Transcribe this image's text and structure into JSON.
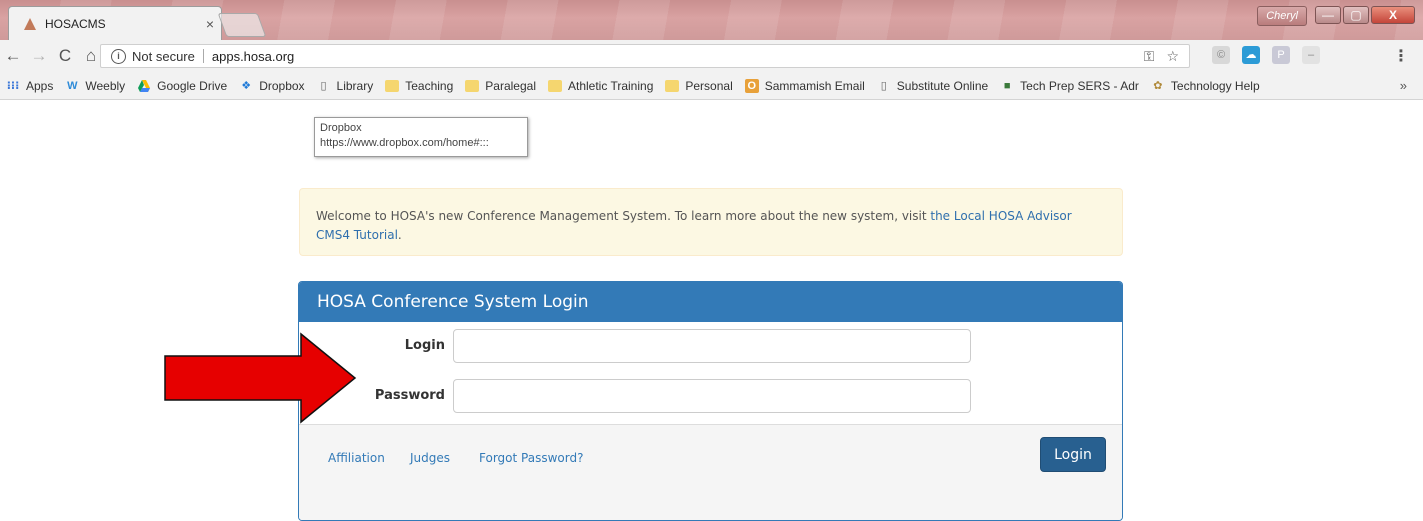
{
  "browser": {
    "tab_title": "HOSACMS",
    "tab_close": "×",
    "window_user": "Cheryl",
    "window_buttons": {
      "minimize": "—",
      "maximize": "▢",
      "close": "X"
    },
    "nav": {
      "back": "←",
      "forward": "→",
      "reload": "C",
      "home": "⌂"
    },
    "security_label": "Not secure",
    "url": "apps.hosa.org",
    "omnibox_icons": [
      "key-icon",
      "star-icon"
    ],
    "menu": "⋮"
  },
  "bookmarks": {
    "items": [
      {
        "label": "Apps",
        "icon": "apps-grid-icon"
      },
      {
        "label": "Weebly",
        "icon": "weebly-icon"
      },
      {
        "label": "Google Drive",
        "icon": "google-drive-icon"
      },
      {
        "label": "Dropbox",
        "icon": "dropbox-icon"
      },
      {
        "label": "Library",
        "icon": "page-icon"
      },
      {
        "label": "Teaching",
        "icon": "folder-icon"
      },
      {
        "label": "Paralegal",
        "icon": "folder-icon"
      },
      {
        "label": "Athletic Training",
        "icon": "folder-icon"
      },
      {
        "label": "Personal",
        "icon": "folder-icon"
      },
      {
        "label": "Sammamish Email",
        "icon": "outlook-icon"
      },
      {
        "label": "Substitute Online",
        "icon": "page-icon"
      },
      {
        "label": "Tech Prep SERS - Adr",
        "icon": "tech-prep-icon"
      },
      {
        "label": "Technology Help",
        "icon": "technology-help-icon"
      }
    ],
    "more": "»"
  },
  "tooltip": {
    "title": "Dropbox",
    "url": "https://www.dropbox.com/home#:::"
  },
  "alert": {
    "text": "Welcome to HOSA's new Conference Management System. To learn more about the new system, visit ",
    "link": "the Local HOSA Advisor CMS4 Tutorial",
    "after": "."
  },
  "login_panel": {
    "heading": "HOSA Conference System Login",
    "login_label": "Login",
    "password_label": "Password",
    "login_value": "",
    "password_value": "",
    "footer_links": [
      "Affiliation",
      "Judges",
      "Forgot Password?"
    ],
    "submit_label": "Login"
  },
  "colors": {
    "primary": "#337ab7",
    "button": "#286090",
    "alert_bg": "#fcf8e3",
    "annotation_arrow": "#e60000"
  }
}
